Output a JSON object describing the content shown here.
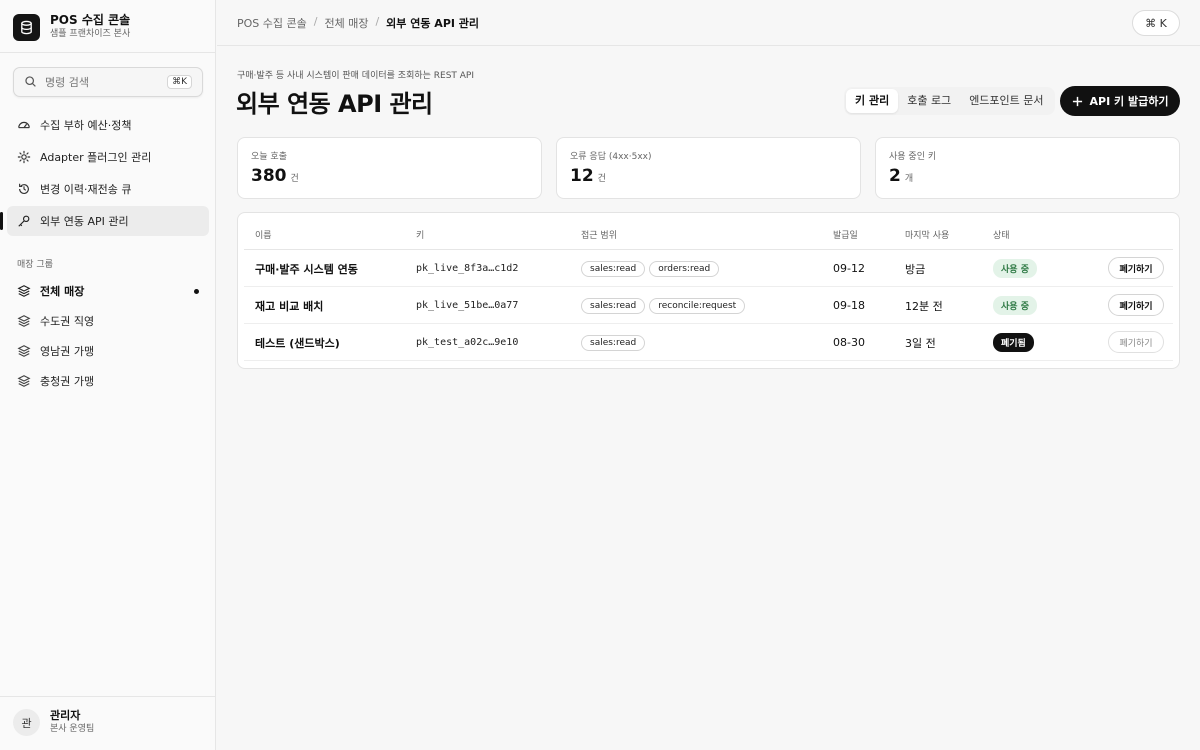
{
  "brand": {
    "title": "POS 수집 콘솔",
    "subtitle": "샘플 프랜차이즈 본사"
  },
  "search": {
    "placeholder": "명령 검색",
    "shortcut": "⌘K"
  },
  "nav": [
    {
      "label": "수집 부하 예산·정책",
      "icon": "gauge-icon"
    },
    {
      "label": "Adapter 플러그인 관리",
      "icon": "plug-icon"
    },
    {
      "label": "변경 이력·재전송 큐",
      "icon": "history-icon"
    },
    {
      "label": "외부 연동 API 관리",
      "icon": "key-icon",
      "active": true
    }
  ],
  "store_groups": {
    "title": "매장 그룹",
    "items": [
      {
        "label": "전체 매장",
        "active": true
      },
      {
        "label": "수도권 직영"
      },
      {
        "label": "영남권 가맹"
      },
      {
        "label": "충청권 가맹"
      }
    ]
  },
  "user": {
    "avatar": "관",
    "name": "관리자",
    "role": "본사 운영팀"
  },
  "breadcrumb": [
    "POS 수집 콘솔",
    "전체 매장",
    "외부 연동 API 관리"
  ],
  "command_button": "⌘ K",
  "page": {
    "description": "구매·발주 등 사내 시스템이 판매 데이터를 조회하는 REST API",
    "title": "외부 연동 API 관리"
  },
  "tabs": [
    {
      "label": "키 관리",
      "active": true
    },
    {
      "label": "호출 로그"
    },
    {
      "label": "엔드포인트 문서"
    }
  ],
  "primary_action": "API 키 발급하기",
  "stats": [
    {
      "label": "오늘 호출",
      "value": "380",
      "unit": "건"
    },
    {
      "label": "오류 응답 (4xx·5xx)",
      "value": "12",
      "unit": "건"
    },
    {
      "label": "사용 중인 키",
      "value": "2",
      "unit": "개"
    }
  ],
  "table": {
    "headers": [
      "이름",
      "키",
      "접근 범위",
      "발급일",
      "마지막 사용",
      "상태"
    ],
    "rows": [
      {
        "name": "구매·발주 시스템 연동",
        "key": "pk_live_8f3a…c1d2",
        "scopes": [
          "sales:read",
          "orders:read"
        ],
        "issued": "09-12",
        "last_used": "방금",
        "status": "사용 중",
        "action": "폐기하기"
      },
      {
        "name": "재고 비교 배치",
        "key": "pk_live_51be…0a77",
        "scopes": [
          "sales:read",
          "reconcile:request"
        ],
        "issued": "09-18",
        "last_used": "12분 전",
        "status": "사용 중",
        "action": "폐기하기"
      },
      {
        "name": "테스트 (샌드박스)",
        "key": "pk_test_a02c…9e10",
        "scopes": [
          "sales:read"
        ],
        "issued": "08-30",
        "last_used": "3일 전",
        "status": "폐기됨",
        "action": "폐기하기"
      }
    ]
  },
  "colors": {
    "accent": "#111111",
    "status_ok_bg": "#e3f3e8",
    "status_ok_text": "#2f7a45"
  }
}
